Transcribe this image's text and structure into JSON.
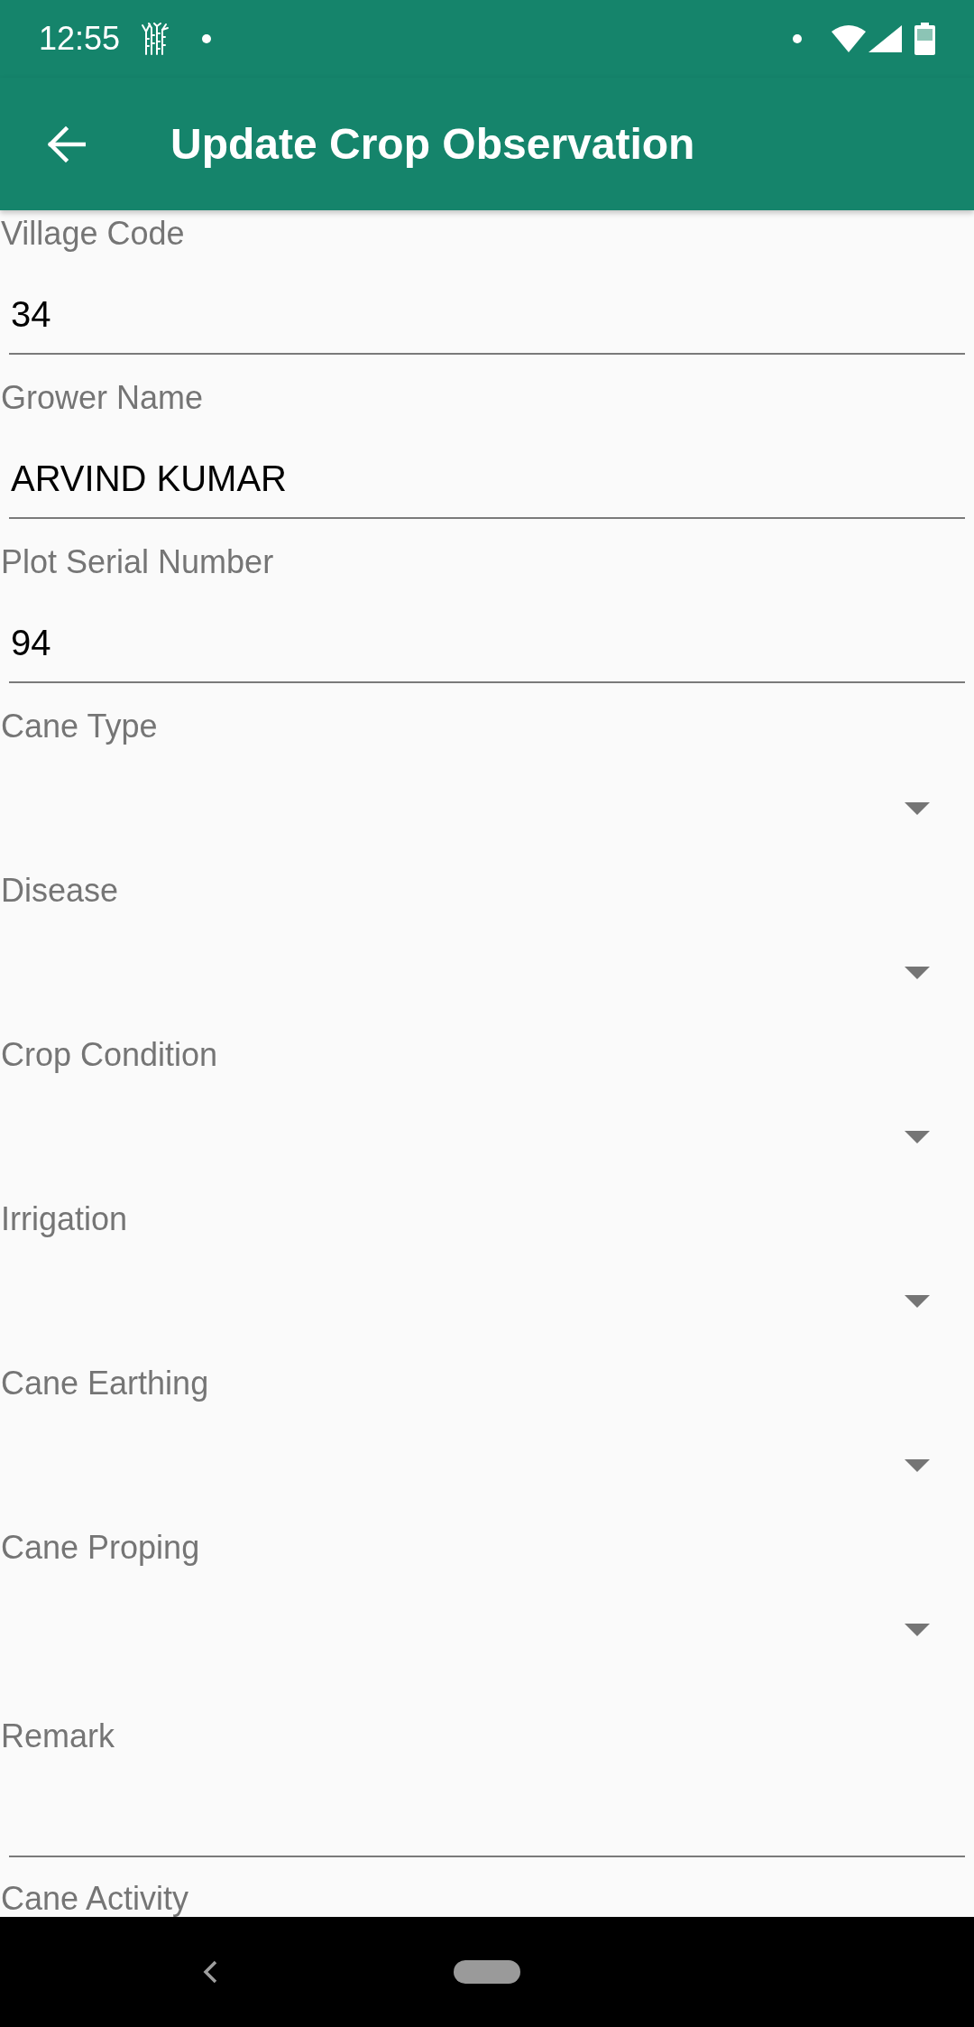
{
  "status_bar": {
    "time": "12:55"
  },
  "app_bar": {
    "title": "Update Crop Observation"
  },
  "fields": [
    {
      "kind": "text",
      "label": "Village Code",
      "value": "34"
    },
    {
      "kind": "text",
      "label": "Grower Name",
      "value": "ARVIND KUMAR"
    },
    {
      "kind": "text",
      "label": "Plot Serial Number",
      "value": "94"
    },
    {
      "kind": "dropdown",
      "label": "Cane Type"
    },
    {
      "kind": "dropdown",
      "label": "Disease"
    },
    {
      "kind": "dropdown",
      "label": "Crop Condition"
    },
    {
      "kind": "dropdown",
      "label": "Irrigation"
    },
    {
      "kind": "dropdown",
      "label": "Cane Earthing"
    },
    {
      "kind": "dropdown",
      "label": "Cane Proping"
    },
    {
      "kind": "text",
      "label": "Remark"
    },
    {
      "kind": "caption",
      "label": "Cane Activity"
    }
  ]
}
